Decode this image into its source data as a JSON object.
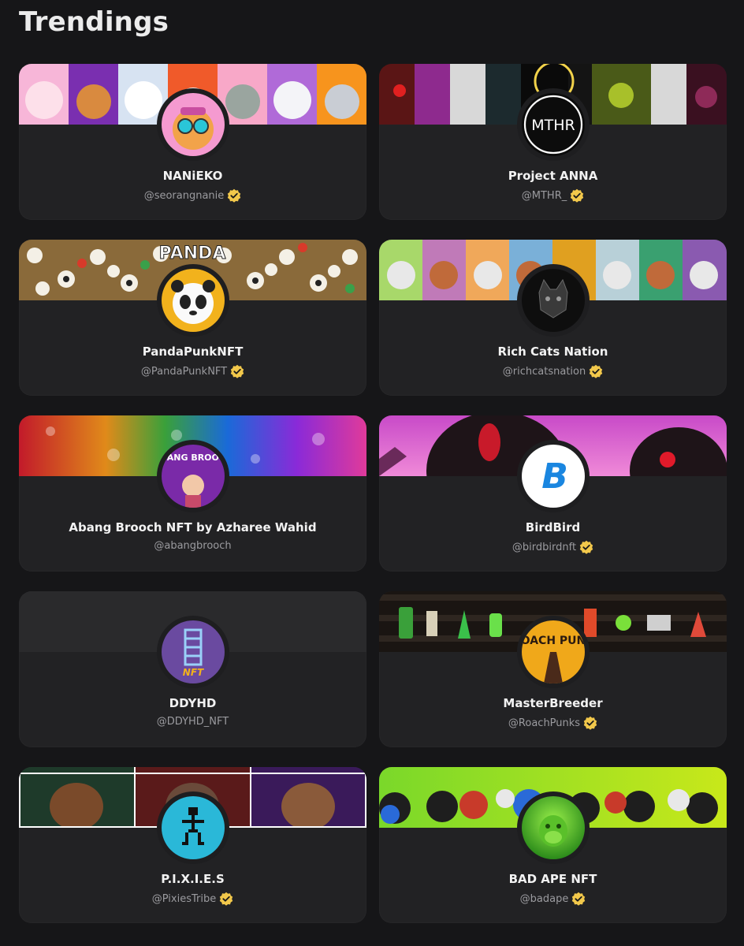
{
  "page": {
    "title": "Trendings"
  },
  "colors": {
    "background": "#161618",
    "card": "#222224",
    "handle": "#9b9b9f",
    "verified_badge": "#f2c84b"
  },
  "collections": [
    {
      "name": "NANiEKO",
      "handle": "@seorangnanie",
      "verified": true,
      "banner_icon": "cartoon-cats-banner",
      "avatar_icon": "cat-with-goggles-avatar"
    },
    {
      "name": "Project ANNA",
      "handle": "@MTHR_",
      "verified": true,
      "banner_icon": "dark-character-banner",
      "avatar_icon": "mthr-logo-avatar",
      "avatar_text": "MTHR"
    },
    {
      "name": "PandaPunkNFT",
      "handle": "@PandaPunkNFT",
      "verified": true,
      "banner_icon": "panda-crowd-banner",
      "banner_text": "PANDA",
      "avatar_icon": "panda-face-avatar"
    },
    {
      "name": "Rich Cats Nation",
      "handle": "@richcatsnation",
      "verified": true,
      "banner_icon": "cat-portraits-banner",
      "avatar_icon": "black-cat-avatar"
    },
    {
      "name": "Abang Brooch NFT by Azharee Wahid",
      "handle": "@abangbrooch",
      "verified": false,
      "banner_icon": "rainbow-glitter-banner",
      "avatar_icon": "abang-brooch-avatar",
      "avatar_text": "ABANG BROOCH"
    },
    {
      "name": "BirdBird",
      "handle": "@birdbirdnft",
      "verified": true,
      "banner_icon": "pink-sky-creature-banner",
      "avatar_icon": "b-logo-avatar",
      "avatar_text": "B"
    },
    {
      "name": "DDYHD",
      "handle": "@DDYHD_NFT",
      "verified": false,
      "banner_icon": "blank-banner",
      "avatar_icon": "ddyhd-logo-avatar",
      "avatar_text": "NFT"
    },
    {
      "name": "MasterBreeder",
      "handle": "@RoachPunks",
      "verified": true,
      "banner_icon": "roachpunk-items-banner",
      "avatar_icon": "roach-punk-avatar",
      "avatar_text": "ROACH PUNK"
    },
    {
      "name": "P.I.X.I.E.S",
      "handle": "@PixiesTribe",
      "verified": true,
      "banner_icon": "robot-bears-banner",
      "avatar_icon": "pixel-figure-avatar"
    },
    {
      "name": "BAD APE NFT",
      "handle": "@badape",
      "verified": true,
      "banner_icon": "ape-crowd-banner",
      "avatar_icon": "green-ape-avatar"
    }
  ]
}
